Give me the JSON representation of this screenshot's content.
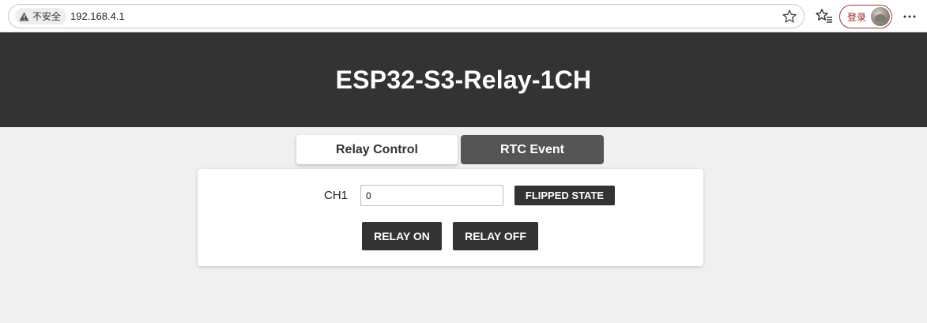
{
  "browser": {
    "security_label": "不安全",
    "url": "192.168.4.1",
    "login_label": "登录"
  },
  "header": {
    "title": "ESP32-S3-Relay-1CH"
  },
  "tabs": [
    {
      "label": "Relay Control",
      "active": true
    },
    {
      "label": "RTC Event",
      "active": false
    }
  ],
  "panel": {
    "channel_label": "CH1",
    "channel_value": "0",
    "flip_label": "FLIPPED STATE",
    "on_label": "RELAY ON",
    "off_label": "RELAY OFF"
  },
  "colors": {
    "header_bg": "#333333",
    "tab_inactive_bg": "#555555",
    "button_bg": "#333333",
    "page_bg": "#f0f0f0"
  }
}
